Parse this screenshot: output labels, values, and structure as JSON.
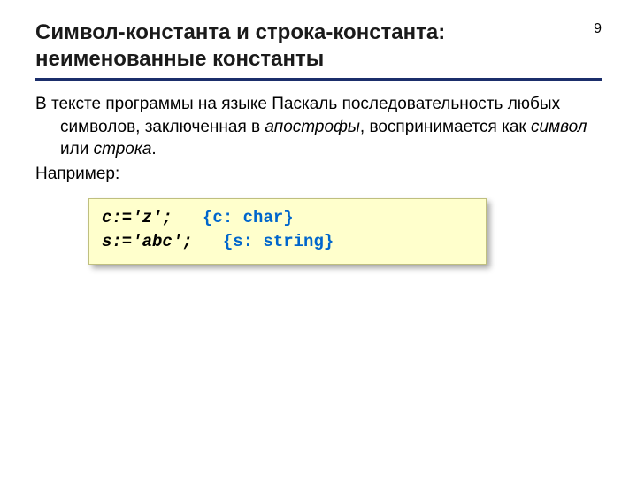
{
  "header": {
    "title": "Символ-константа и строка-константа: неименованные константы",
    "page_number": "9"
  },
  "body": {
    "p1_a": "В тексте программы на языке Паскаль последовательность",
    "p1_b": "любых символов, заключенная в ",
    "p1_em1": "апострофы",
    "p1_c": ",",
    "p1_d": "воспринимается как ",
    "p1_em2": "символ",
    "p1_e": " или ",
    "p1_em3": "строка",
    "p1_f": ".",
    "p2": "Например:"
  },
  "code": {
    "l1_code": "c:='z';   ",
    "l1_comment": "{c: char}",
    "l2_code": "s:='abc';   ",
    "l2_comment": "{s: string}"
  }
}
